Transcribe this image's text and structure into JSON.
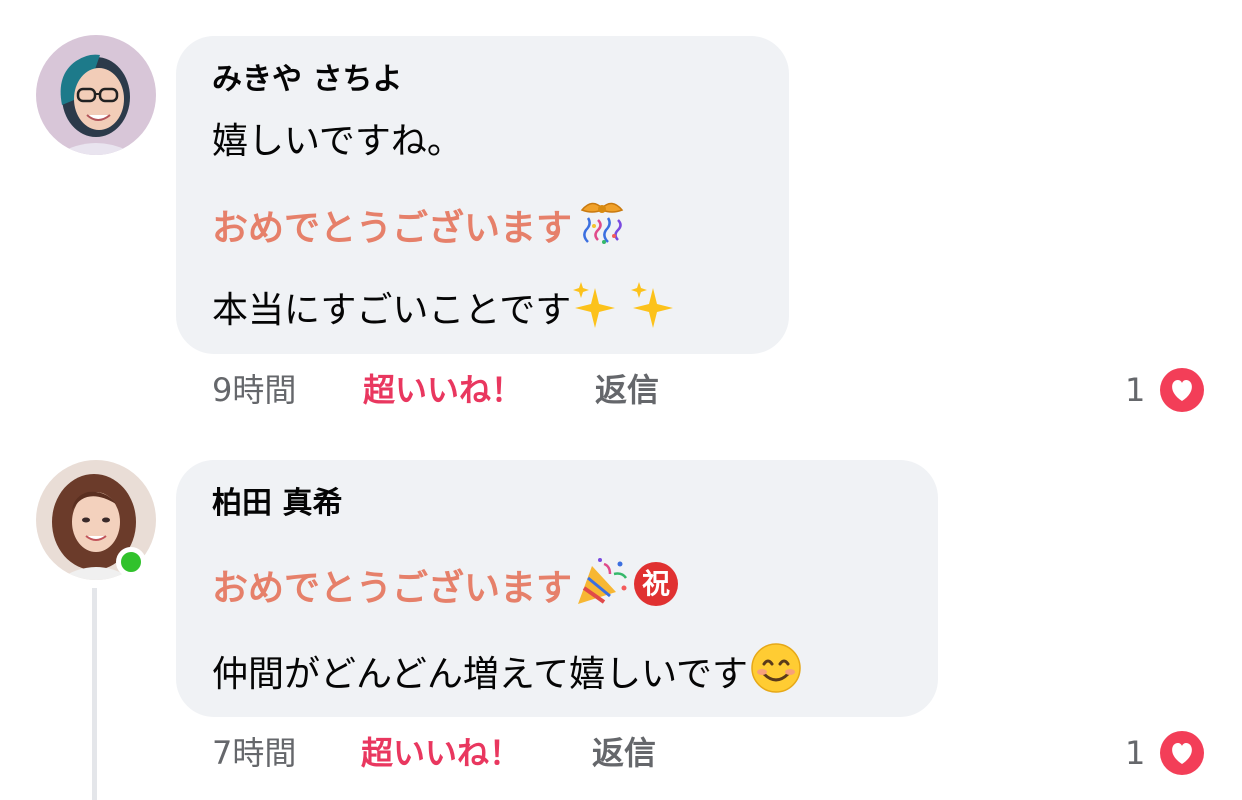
{
  "comments": [
    {
      "author": "みきや さちよ",
      "lines": [
        "嬉しいですね。",
        "おめでとうございます",
        "本当にすごいことです"
      ],
      "emojis": [
        "wrapped-gift-confetti-emoji",
        "sparkles-emoji"
      ],
      "time": "9時間",
      "like_label": "超いいね！",
      "reply_label": "返信",
      "reaction_count": "1",
      "reaction_icon": "heart-icon",
      "online": false
    },
    {
      "author": "柏田 真希",
      "lines": [
        "おめでとうございます",
        "仲間がどんどん増えて嬉しいです"
      ],
      "emojis": [
        "party-popper-emoji",
        "celebration-kanji-emoji",
        "smiling-face-emoji"
      ],
      "congrats_badge_text": "祝",
      "time": "7時間",
      "like_label": "超いいね！",
      "reply_label": "返信",
      "reaction_count": "1",
      "reaction_icon": "heart-icon",
      "online": true
    }
  ],
  "colors": {
    "bubble_bg": "#f0f2f5",
    "accent_text": "#e6806a",
    "super_like": "#e9375f",
    "meta_gray": "#65676b",
    "online_green": "#31c22c",
    "heart_red": "#f33e58"
  }
}
